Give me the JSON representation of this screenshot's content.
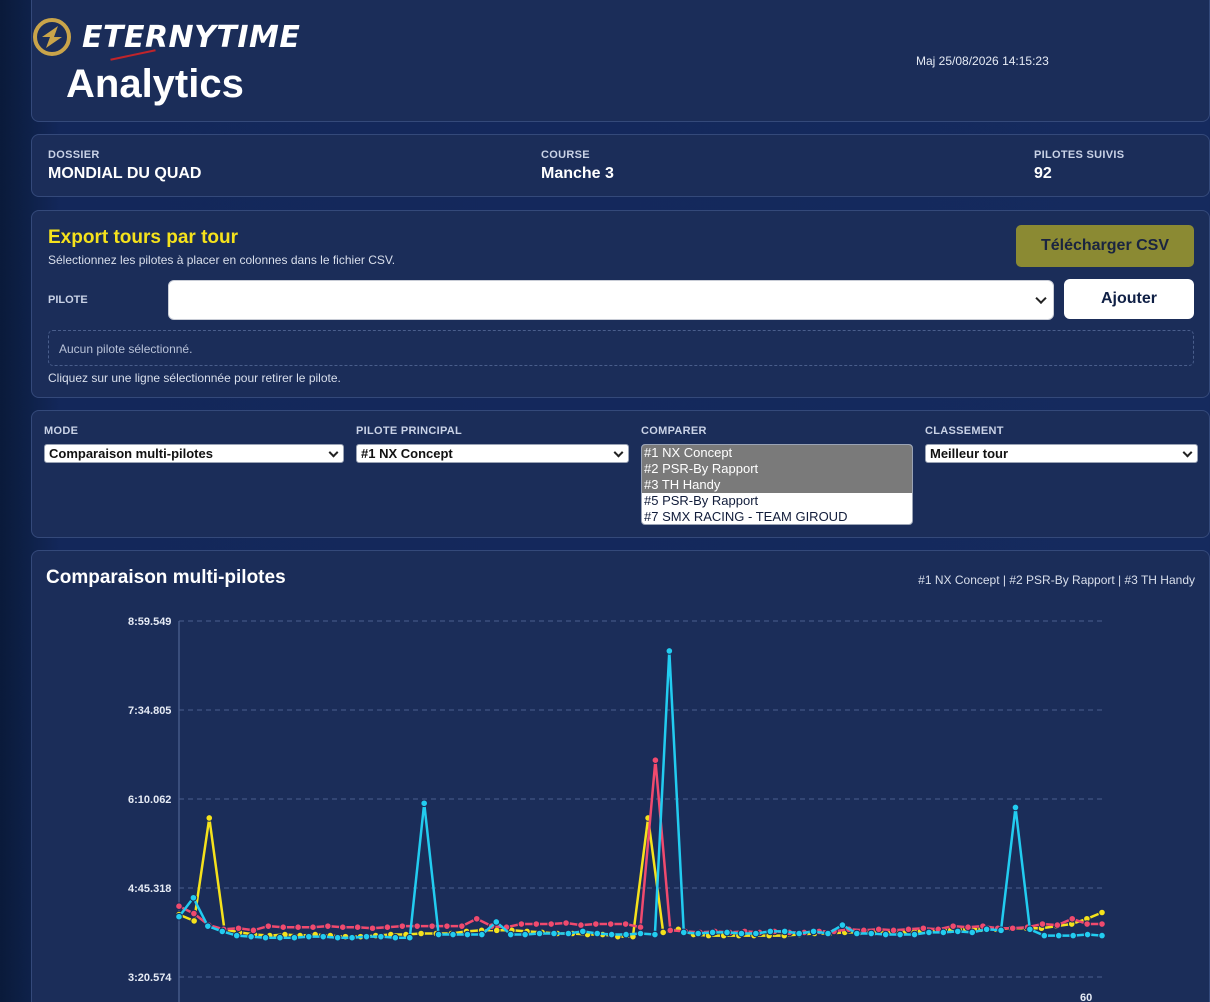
{
  "header": {
    "logo_text": "ETERNYTIME",
    "page_title": "Analytics",
    "update_time": "Maj 25/08/2026 14:15:23"
  },
  "info": {
    "dossier_label": "DOSSIER",
    "dossier_value": "MONDIAL DU QUAD",
    "course_label": "COURSE",
    "course_value": "Manche 3",
    "pilotes_label": "PILOTES SUIVIS",
    "pilotes_value": "92"
  },
  "export": {
    "title": "Export tours par tour",
    "subtitle": "Sélectionnez les pilotes à placer en colonnes dans le fichier CSV.",
    "csv_button": "Télécharger CSV",
    "pilote_label": "PILOTE",
    "pilote_value": "",
    "add_button": "Ajouter",
    "empty_text": "Aucun pilote sélectionné.",
    "hint": "Cliquez sur une ligne sélectionnée pour retirer le pilote."
  },
  "controls": {
    "mode_label": "MODE",
    "mode_value": "Comparaison multi-pilotes",
    "principal_label": "PILOTE PRINCIPAL",
    "principal_value": "#1 NX Concept",
    "compare_label": "COMPARER",
    "compare_options": [
      {
        "label": "#1 NX Concept",
        "selected": true
      },
      {
        "label": "#2 PSR-By Rapport",
        "selected": true
      },
      {
        "label": "#3 TH Handy",
        "selected": true
      },
      {
        "label": "#5 PSR-By Rapport",
        "selected": false
      },
      {
        "label": "#7 SMX RACING - TEAM GIROUD",
        "selected": false
      }
    ],
    "classement_label": "CLASSEMENT",
    "classement_value": "Meilleur tour"
  },
  "chart": {
    "title": "Comparaison multi-pilotes",
    "legend_text": "#1 NX Concept | #2 PSR-By Rapport | #3 TH Handy"
  },
  "chart_data": {
    "type": "line",
    "title": "Comparaison multi-pilotes",
    "y_ticks": [
      "8:59.549",
      "7:34.805",
      "6:10.062",
      "4:45.318",
      "3:20.574"
    ],
    "ylim": [
      200.574,
      539.549
    ],
    "x_tick_labels": [
      "60"
    ],
    "x_range": [
      1,
      60
    ],
    "grid": true,
    "series": [
      {
        "name": "#1 NX Concept",
        "color": "#f5e21c",
        "values": [
          260,
          254,
          352,
          246,
          243,
          241,
          240,
          241,
          240,
          241,
          240,
          239,
          239,
          240,
          241,
          241,
          242,
          242,
          242,
          244,
          245,
          245,
          245,
          244,
          243,
          242,
          242,
          241,
          241,
          239,
          239,
          352,
          243,
          246,
          241,
          240,
          240,
          240,
          240,
          240,
          240,
          241,
          242,
          242,
          243,
          243,
          243,
          243,
          244,
          244,
          245,
          245,
          246,
          246,
          246,
          247,
          247,
          247,
          249,
          251,
          256,
          262
        ]
      },
      {
        "name": "#2 PSR-By Rapport",
        "color": "#f04a6e",
        "values": [
          268,
          261,
          250,
          246,
          247,
          245,
          249,
          248,
          248,
          248,
          249,
          248,
          248,
          247,
          248,
          249,
          249,
          249,
          249,
          249,
          256,
          249,
          248,
          251,
          251,
          251,
          252,
          250,
          251,
          251,
          251,
          248,
          407,
          245,
          244,
          243,
          244,
          243,
          244,
          243,
          244,
          243,
          243,
          244,
          244,
          246,
          245,
          246,
          245,
          246,
          247,
          246,
          249,
          248,
          249,
          247,
          247,
          248,
          251,
          250,
          256,
          251,
          251
        ]
      },
      {
        "name": "#3 TH Handy",
        "color": "#22ccf0",
        "values": [
          258,
          276,
          249,
          244,
          240,
          239,
          238,
          238,
          238,
          239,
          239,
          238,
          238,
          239,
          239,
          238,
          238,
          366,
          241,
          241,
          241,
          241,
          253,
          241,
          241,
          242,
          242,
          242,
          244,
          242,
          241,
          241,
          242,
          241,
          511,
          243,
          242,
          243,
          243,
          242,
          242,
          244,
          244,
          242,
          244,
          242,
          250,
          242,
          242,
          241,
          241,
          241,
          243,
          243,
          244,
          243,
          246,
          245,
          362,
          246,
          240,
          240,
          240,
          241,
          240
        ]
      }
    ]
  }
}
